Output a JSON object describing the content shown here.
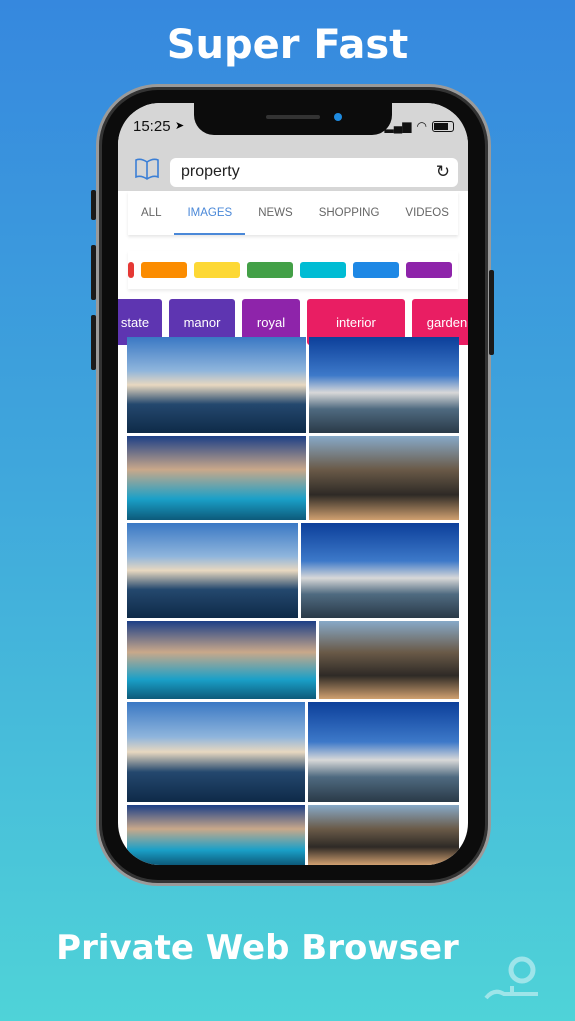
{
  "headline_top": "Super Fast",
  "headline_bottom": "Private Web Browser",
  "status": {
    "time": "15:25"
  },
  "search": {
    "query": "property"
  },
  "tabs": [
    {
      "label": "ALL"
    },
    {
      "label": "IMAGES",
      "active": true
    },
    {
      "label": "NEWS"
    },
    {
      "label": "SHOPPING"
    },
    {
      "label": "VIDEOS"
    }
  ],
  "color_filters": [
    "#e53935",
    "#fb8c00",
    "#fdd835",
    "#43a047",
    "#00bcd4",
    "#1e88e5",
    "#8e24aa"
  ],
  "chips": [
    {
      "label": "state",
      "color": "#5e35b1"
    },
    {
      "label": "manor",
      "color": "#5e35b1"
    },
    {
      "label": "royal",
      "color": "#8e24aa"
    },
    {
      "label": "interior",
      "color": "#e91e63"
    },
    {
      "label": "garden",
      "color": "#e91e63"
    }
  ],
  "image_rows": [
    {
      "h": 96,
      "w": [
        179,
        150
      ]
    },
    {
      "h": 84,
      "w": [
        179,
        150
      ]
    },
    {
      "h": 95,
      "w": [
        171,
        158
      ]
    },
    {
      "h": 78,
      "w": [
        189,
        140
      ]
    },
    {
      "h": 100,
      "w": [
        178,
        151
      ]
    },
    {
      "h": 60,
      "w": [
        178,
        151
      ]
    }
  ]
}
